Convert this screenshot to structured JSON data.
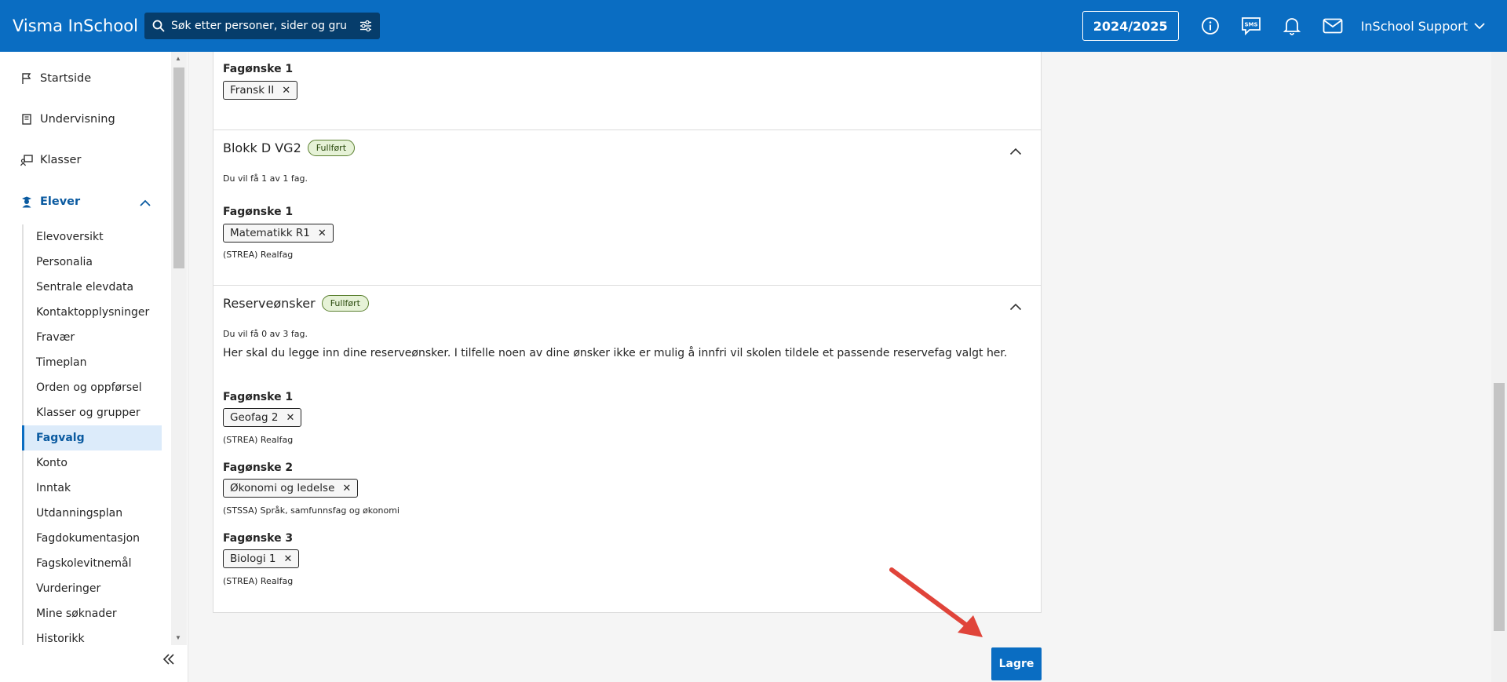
{
  "header": {
    "brand": "Visma InSchool",
    "search_placeholder": "Søk etter personer, sider og gru",
    "school_year": "2024/2025",
    "user_name": "InSchool Support",
    "sms_label": "SMS"
  },
  "sidebar": {
    "nav": [
      {
        "label": "Startside",
        "icon": "flag-icon"
      },
      {
        "label": "Undervisning",
        "icon": "book-icon"
      },
      {
        "label": "Klasser",
        "icon": "classroom-icon"
      },
      {
        "label": "Elever",
        "icon": "student-icon"
      }
    ],
    "sub_items": [
      "Elevoversikt",
      "Personalia",
      "Sentrale elevdata",
      "Kontaktopplysninger",
      "Fravær",
      "Timeplan",
      "Orden og oppførsel",
      "Klasser og grupper",
      "Fagvalg",
      "Konto",
      "Inntak",
      "Utdanningsplan",
      "Fagdokumentasjon",
      "Fagskolevitnemål",
      "Vurderinger",
      "Mine søknader",
      "Historikk"
    ],
    "selected": "Fagvalg"
  },
  "main": {
    "top_partial": {
      "wish_label": "Fagønske 1",
      "chip": "Fransk II"
    },
    "blokk_d": {
      "title": "Blokk D VG2",
      "badge": "Fullført",
      "info": "Du vil få 1 av 1 fag.",
      "wish_label": "Fagønske 1",
      "chip": "Matematikk R1",
      "category": "(STREA) Realfag"
    },
    "reserve": {
      "title": "Reserveønsker",
      "badge": "Fullført",
      "info": "Du vil få 0 av 3 fag.",
      "description": "Her skal du legge inn dine reserveønsker. I tilfelle noen av dine ønsker ikke er mulig å innfri vil skolen tildele et passende reservefag valgt her.",
      "wishes": [
        {
          "label": "Fagønske 1",
          "chip": "Geofag 2",
          "category": "(STREA) Realfag"
        },
        {
          "label": "Fagønske 2",
          "chip": "Økonomi og ledelse",
          "category": "(STSSA) Språk, samfunnsfag og økonomi"
        },
        {
          "label": "Fagønske 3",
          "chip": "Biologi 1",
          "category": "(STREA) Realfag"
        }
      ]
    },
    "remove_glyph": "✕",
    "save_label": "Lagre"
  },
  "colors": {
    "topbar": "#0a6dc2",
    "search_bg": "#063d6b",
    "badge_bg": "#e6f2d7",
    "selected_bg": "#dcebfa",
    "save_button": "#0a6dc2",
    "annotation_arrow": "#e0443a"
  }
}
